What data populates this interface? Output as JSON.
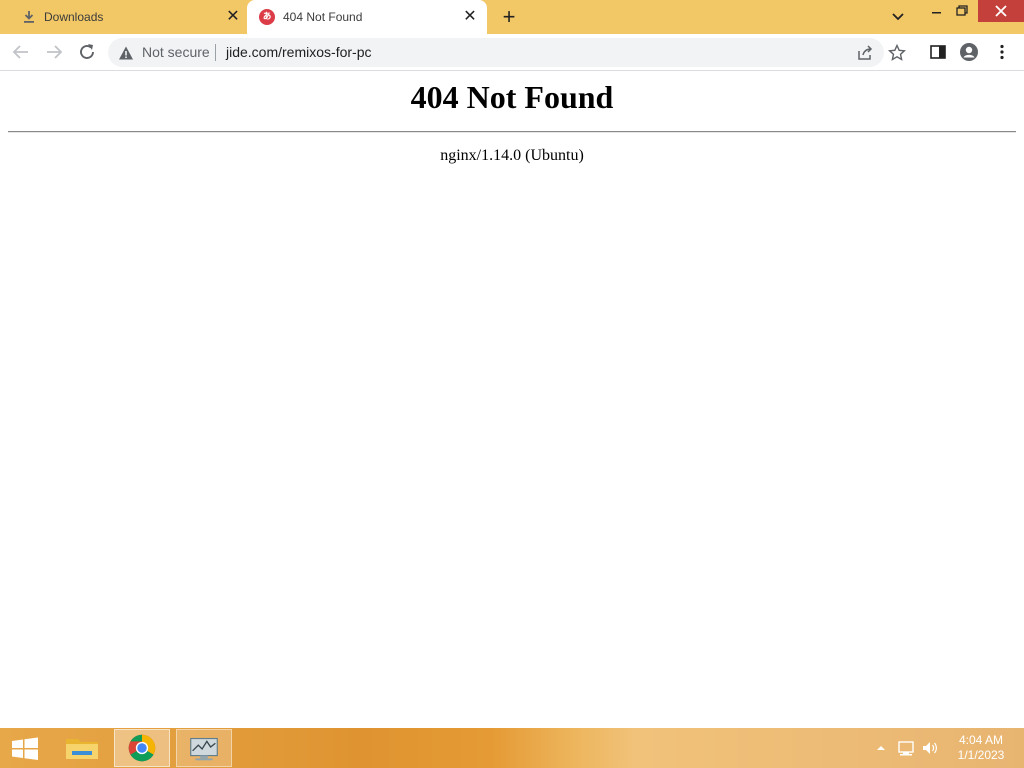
{
  "tabs": [
    {
      "title": "Downloads",
      "icon": "download-icon",
      "active": false
    },
    {
      "title": "404 Not Found",
      "icon": "site-favicon",
      "active": true
    }
  ],
  "omnibox": {
    "security_label": "Not secure",
    "url": "jide.com/remixos-for-pc"
  },
  "page": {
    "heading": "404 Not Found",
    "server": "nginx/1.14.0 (Ubuntu)"
  },
  "taskbar": {
    "time": "4:04 AM",
    "date": "1/1/2023",
    "pinned": [
      "start-icon",
      "file-explorer-icon",
      "chrome-icon",
      "resource-monitor-icon"
    ]
  },
  "colors": {
    "tabstrip": "#f2c766",
    "favicon": "#dc3c48",
    "close_button": "#c4413b"
  }
}
